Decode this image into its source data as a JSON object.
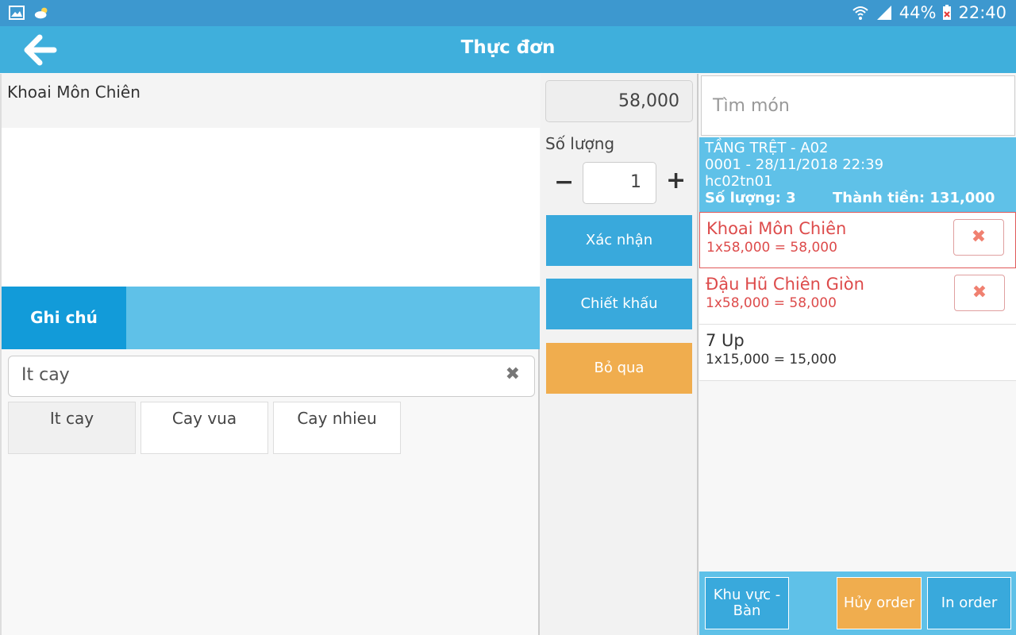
{
  "status_bar": {
    "battery": "44%",
    "time": "22:40"
  },
  "app_bar": {
    "title": "Thực đơn"
  },
  "item": {
    "name": "Khoai Môn Chiên"
  },
  "tabs": {
    "note_label": "Ghi chú"
  },
  "note": {
    "value": "It cay",
    "clear_icon": "✖"
  },
  "note_options": [
    "It cay",
    "Cay vua",
    "Cay nhieu"
  ],
  "middle": {
    "price": "58,000",
    "quantity_label": "Số lượng",
    "quantity": "1",
    "minus": "−",
    "plus": "+",
    "confirm_label": "Xác nhận",
    "discount_label": "Chiết khấu",
    "skip_label": "Bỏ qua"
  },
  "search": {
    "placeholder": "Tìm món"
  },
  "order": {
    "location": "TẦNG TRỆT - A02",
    "code_time": "0001 - 28/11/2018 22:39",
    "user": "hc02tn01",
    "quantity_text": "Số lượng: 3",
    "total_text": "Thành tiền: 131,000"
  },
  "order_items": [
    {
      "name": "Khoai Môn Chiên",
      "detail": "1x58,000 = 58,000"
    },
    {
      "name": "Đậu Hũ Chiên Giòn",
      "detail": "1x58,000 = 58,000"
    },
    {
      "name": "7 Up",
      "detail": "1x15,000 = 15,000"
    }
  ],
  "delete_icon": "✖",
  "bottom": {
    "area_line1": "Khu vực -",
    "area_line2": "Bàn",
    "cancel_label": "Hủy order",
    "print_label": "In order"
  },
  "colors": {
    "primary": "#3fafdc",
    "accent": "#f0ad4e",
    "danger": "#dd4b4b"
  }
}
